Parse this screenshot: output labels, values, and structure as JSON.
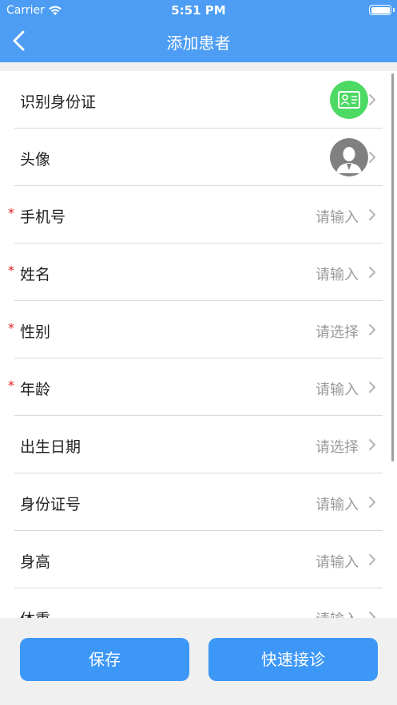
{
  "status_bar": {
    "carrier": "Carrier",
    "time": "5:51 PM"
  },
  "nav": {
    "title": "添加患者",
    "back_icon": "chevron-left-icon"
  },
  "form": {
    "rows": [
      {
        "label": "识别身份证",
        "required": false,
        "icon": "id-card-icon"
      },
      {
        "label": "头像",
        "required": false,
        "icon": "avatar-placeholder-icon"
      },
      {
        "label": "手机号",
        "required": true,
        "value": "请输入"
      },
      {
        "label": "姓名",
        "required": true,
        "value": "请输入"
      },
      {
        "label": "性别",
        "required": true,
        "value": "请选择"
      },
      {
        "label": "年龄",
        "required": true,
        "value": "请输入"
      },
      {
        "label": "出生日期",
        "required": false,
        "value": "请选择"
      },
      {
        "label": "身份证号",
        "required": false,
        "value": "请输入"
      },
      {
        "label": "身高",
        "required": false,
        "value": "请输入"
      },
      {
        "label": "体重",
        "required": false,
        "value": "请输入"
      }
    ],
    "required_mark": "*"
  },
  "footer": {
    "save_label": "保存",
    "quick_visit_label": "快速接诊"
  },
  "colors": {
    "primary": "#4c9df3",
    "button": "#3d97f7",
    "id_card_green": "#4cd964",
    "required": "#e02020"
  }
}
